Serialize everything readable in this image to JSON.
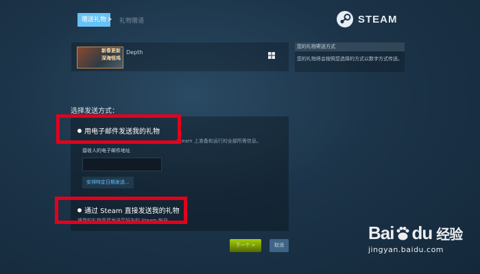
{
  "breadcrumb": {
    "active": "赠送礼物",
    "next": "礼物赠语"
  },
  "logo": {
    "text": "STEAM"
  },
  "product": {
    "name": "Depth",
    "thumb_line1": "新春更新",
    "thumb_line2": "深海怪鸡",
    "platform_icon": "windows-icon"
  },
  "side": {
    "title": "您的礼物寄送方式",
    "body": "您的礼物将会按照您选择的方式以数字方式传送。"
  },
  "delivery": {
    "title": "选择发送方式：",
    "option_email": "用电子邮件发送我的礼物",
    "email_desc_tail": "Steam 上准备和运行的全部所需信息。",
    "email_label": "接收人的电子邮件地址",
    "email_value": "",
    "schedule_label": "安排特定日期发送...",
    "option_steam": "通过 Steam 直接发送我的礼物",
    "steam_desc": "将我的礼物直接发送至好友的 Steam 帐户。"
  },
  "buttons": {
    "next": "下一个 >",
    "cancel": "取消"
  },
  "watermark": {
    "brand": "Bai",
    "brand2": "du",
    "cn": "经验",
    "url": "jingyan.baidu.com"
  },
  "colors": {
    "highlight": "#e4001b",
    "accent": "#67c1f5",
    "next_button": "#a4d007"
  }
}
